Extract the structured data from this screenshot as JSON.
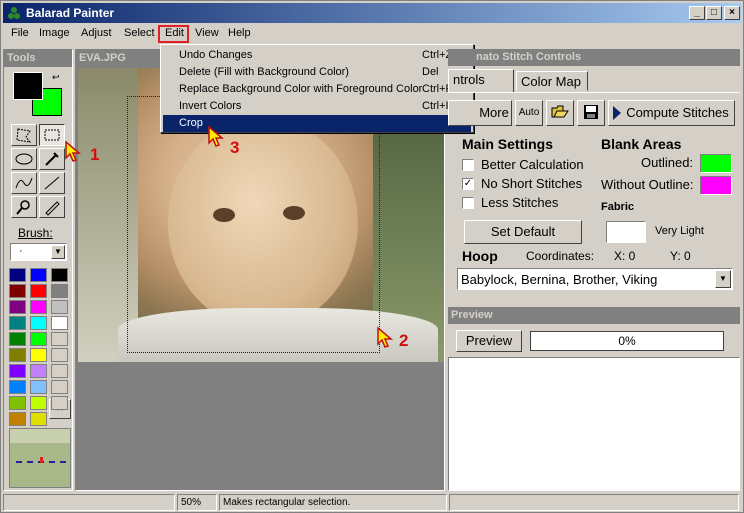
{
  "window": {
    "title": "Balarad Painter",
    "min": "_",
    "max": "□",
    "close": "×"
  },
  "menu": {
    "file": "File",
    "image": "Image",
    "adjust": "Adjust",
    "select": "Select",
    "edit": "Edit",
    "view": "View",
    "help": "Help"
  },
  "edit_menu": [
    {
      "label": "Undo Changes",
      "shortcut": "Ctrl+Z"
    },
    {
      "label": "Delete  (Fill with Background Color)",
      "shortcut": "Del"
    },
    {
      "label": "Replace Background Color with Foreground Color",
      "shortcut": "Ctrl+R"
    },
    {
      "label": "Invert Colors",
      "shortcut": "Ctrl+I"
    },
    {
      "label": "Crop",
      "shortcut": ""
    }
  ],
  "tools": {
    "title": "Tools",
    "brush_label": "Brush:",
    "brush_value": "·"
  },
  "canvas": {
    "filename": "EVA.JPG"
  },
  "stitch": {
    "title": "nato Stitch Controls",
    "tab_controls": "ntrols",
    "tab_colormap": "Color Map",
    "more": "More",
    "auto": "Auto",
    "compute": "Compute Stitches",
    "main_settings": "Main Settings",
    "better_calc": "Better Calculation",
    "no_short": "No Short Stitches",
    "less": "Less Stitches",
    "set_default": "Set Default",
    "blank_areas": "Blank Areas",
    "outlined": "Outlined:",
    "without_outline": "Without Outline:",
    "fabric": "Fabric",
    "very_light": "Very Light",
    "hoop": "Hoop",
    "coordinates": "Coordinates:",
    "x": "X:  0",
    "y": "Y:  0",
    "machine": "Babylock, Bernina, Brother, Viking"
  },
  "preview": {
    "title": "Preview",
    "button": "Preview",
    "progress": "0%",
    "progress_value": 0
  },
  "status": {
    "zoom": "50%",
    "message": "Makes rectangular selection."
  },
  "annotations": {
    "n1": "1",
    "n2": "2",
    "n3": "3"
  },
  "colors": {
    "outlined": "#00ff00",
    "without_outline": "#ff00ff",
    "fg": "#000000",
    "bg": "#00ff00"
  },
  "palette": [
    "#000080",
    "#0000ff",
    "#000000",
    "#800000",
    "#ff0000",
    "#808080",
    "#800080",
    "#ff00ff",
    "#c0c0c0",
    "#008080",
    "#00ffff",
    "#ffffff",
    "#008000",
    "#00ff00",
    "#d4d0c8",
    "#808000",
    "#ffff00",
    "#d4d0c8",
    "#8000ff",
    "#c080ff",
    "#d4d0c8",
    "#0080ff",
    "#80c0ff",
    "#d4d0c8",
    "#80c000",
    "#c0ff00",
    "#d4d0c8",
    "#c08000",
    "#e0e000",
    "#d4d0c8"
  ]
}
